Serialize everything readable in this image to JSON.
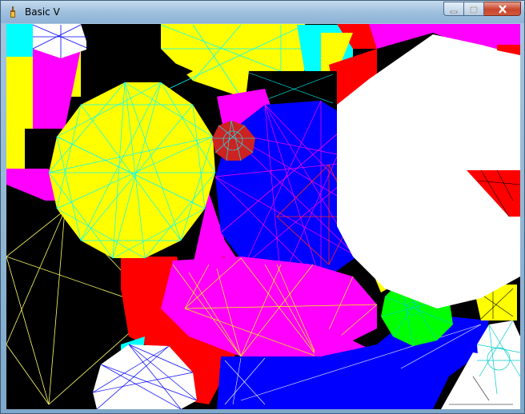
{
  "window": {
    "title": "Basic V",
    "icon": "app-icon",
    "controls": {
      "minimize": "minimize-icon",
      "maximize": "maximize-icon",
      "close": "close-icon"
    }
  },
  "canvas": {
    "content": "random-polygon-graphics",
    "colors": {
      "black": "#000000",
      "white": "#ffffff",
      "red": "#ff0000",
      "yellow": "#ffff00",
      "magenta": "#ff00ff",
      "blue": "#0000ff",
      "cyan": "#00ffff",
      "green": "#00ff00"
    }
  }
}
